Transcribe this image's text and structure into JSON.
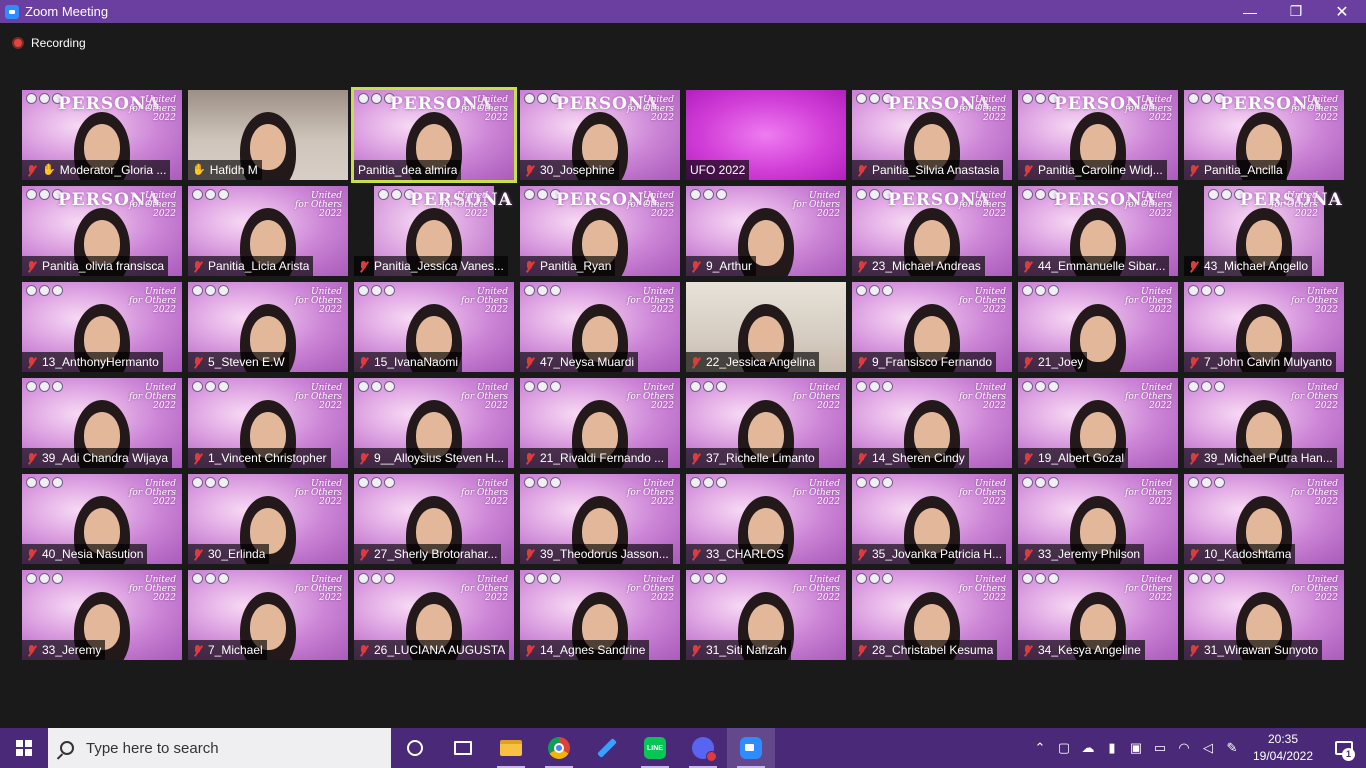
{
  "window": {
    "title": "Zoom Meeting",
    "minimize": "—",
    "maximize": "❐",
    "close": "✕"
  },
  "recording": {
    "label": "Recording"
  },
  "participants": [
    [
      "Moderator_Gloria ...",
      "Hafidh M",
      "Panitia_dea almira",
      "30_Josephine",
      "UFO 2022",
      "Panitia_Silvia Anastasia",
      "Panitia_Caroline Widj...",
      "Panitia_Ancilla"
    ],
    [
      "Panitia_olivia fransisca",
      "Panitia_Licia Arista",
      "Panitia_Jessica Vanes...",
      "Panitia_Ryan",
      "9_Arthur",
      "23_Michael Andreas",
      "44_Emmanuelle Sibar...",
      "43_Michael Angello"
    ],
    [
      "13_AnthonyHermanto",
      "5_Steven E.W",
      "15_IvanaNaomi",
      "47_Neysa Muardi",
      "22_Jessica Angelina",
      "9_Fransisco Fernando",
      "21_Joey",
      "7_John Calvin Mulyanto"
    ],
    [
      "39_Adi Chandra Wijaya",
      "1_Vincent Christopher",
      "9__Alloysius Steven H...",
      "21_Rivaldi Fernando ...",
      "37_Richelle Limanto",
      "14_Sheren Cindy",
      "19_Albert Gozal",
      "39_Michael Putra Han..."
    ],
    [
      "40_Nesia Nasution",
      "30_Erlinda",
      "27_Sherly Brotorahar...",
      "39_Theodorus Jasson...",
      "33_CHARLOS",
      "35_Jovanka Patricia H...",
      "33_Jeremy Philson",
      "10_Kadoshtama"
    ],
    [
      "33_Jeremy",
      "7_Michael",
      "26_LUCIANA AUGUSTA",
      "14_Agnes Sandrine",
      "31_Siti Nafizah",
      "28_Christabel Kesuma",
      "34_Kesya Angeline",
      "31_Wirawan Sunyoto"
    ]
  ],
  "tile_bg_texts": {
    "persona": "PERSONA",
    "brand_line1": "United",
    "brand_line2": "for Others",
    "brand_line3": "2022"
  },
  "taskbar": {
    "search_placeholder": "Type here to search",
    "line_label": "LINE",
    "time": "20:35",
    "date": "19/04/2022",
    "notification_count": "1"
  },
  "colors": {
    "titlebar": "#6b3fa0",
    "taskbar": "#4a2a78",
    "active_speaker_border": "#c7e04a",
    "muted_mic": "#e03b3b"
  }
}
